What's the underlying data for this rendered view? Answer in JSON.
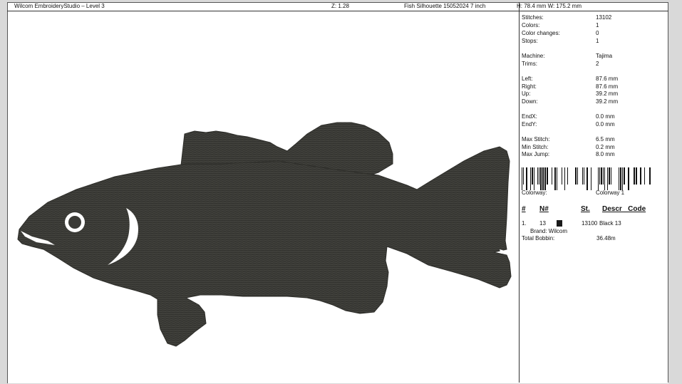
{
  "header": {
    "app_title": "Wilcom EmbroideryStudio – Level 3",
    "zoom": "Z: 1.28",
    "design_name": "Fish Silhouette 15052024 7 inch",
    "dimensions": "H: 78.4 mm   W: 175.2 mm"
  },
  "design": {
    "fill_color": "#3a3a36",
    "hole_color": "#ffffff",
    "description": "fish-silhouette-embroidery"
  },
  "stats": {
    "stitches": {
      "label": "Stitches:",
      "value": "13102"
    },
    "colors": {
      "label": "Colors:",
      "value": "1"
    },
    "color_changes": {
      "label": "Color changes:",
      "value": "0"
    },
    "stops": {
      "label": "Stops:",
      "value": "1"
    },
    "machine": {
      "label": "Machine:",
      "value": "Tajima"
    },
    "trims": {
      "label": "Trims:",
      "value": "2"
    },
    "left": {
      "label": "Left:",
      "value": "87.6 mm"
    },
    "right": {
      "label": "Right:",
      "value": "87.6 mm"
    },
    "up": {
      "label": "Up:",
      "value": "39.2 mm"
    },
    "down": {
      "label": "Down:",
      "value": "39.2 mm"
    },
    "endx": {
      "label": "EndX:",
      "value": "0.0 mm"
    },
    "endy": {
      "label": "EndY:",
      "value": "0.0 mm"
    },
    "max_stitch": {
      "label": "Max Stitch:",
      "value": "6.5 mm"
    },
    "min_stitch": {
      "label": "Min Stitch:",
      "value": "0.2 mm"
    },
    "max_jump": {
      "label": "Max Jump:",
      "value": "8.0 mm"
    }
  },
  "colorway": {
    "label": "Colorway:",
    "value": "Colorway 1"
  },
  "thread_table": {
    "headers": {
      "index": "#",
      "number": "N#",
      "stitches": "St.",
      "descr_code": "Descr _Code"
    },
    "rows": [
      {
        "index": "1.",
        "number": "13",
        "swatch_color": "#1a1a1a",
        "stitches": "13100",
        "descr": "Black 13",
        "brand": "Brand: Wilcom"
      }
    ]
  },
  "total_bobbin": {
    "label": "Total Bobbin:",
    "value": "36.48m"
  }
}
